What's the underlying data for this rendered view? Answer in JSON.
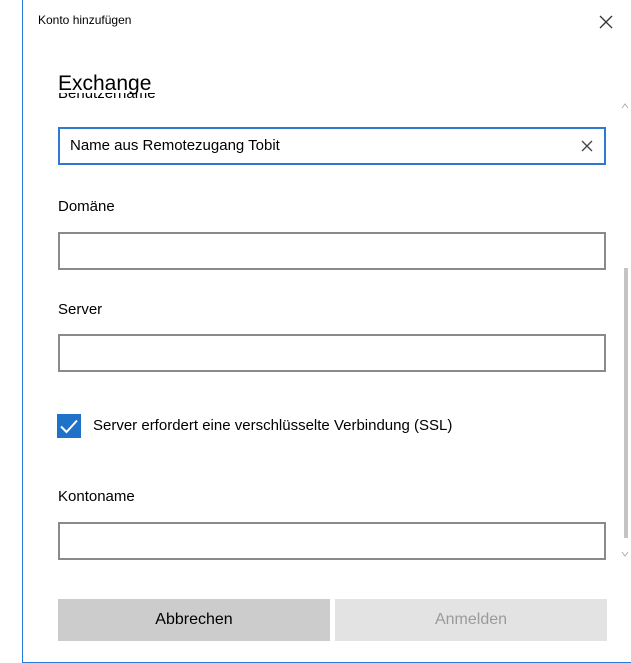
{
  "dialog": {
    "title": "Konto hinzufügen",
    "heading": "Exchange"
  },
  "form": {
    "username_label": "Benutzername",
    "username_value": "Name aus Remotezugang Tobit",
    "domain_label": "Domäne",
    "domain_value": "",
    "server_label": "Server",
    "server_value": "",
    "ssl_label": "Server erfordert eine verschlüsselte Verbindung (SSL)",
    "ssl_checked": true,
    "account_name_label": "Kontoname",
    "account_name_value": ""
  },
  "buttons": {
    "cancel": "Abbrechen",
    "sign_in": "Anmelden"
  },
  "colors": {
    "accent": "#1f72c9",
    "focus_border": "#2e7ad1",
    "window_border": "#2b7bd6",
    "cancel_bg": "#cccccc",
    "disabled_bg": "#e3e3e3",
    "disabled_text": "#9a9a9a"
  },
  "icons": {
    "close": "close-icon",
    "clear": "clear-icon",
    "checkmark": "checkmark-icon"
  }
}
